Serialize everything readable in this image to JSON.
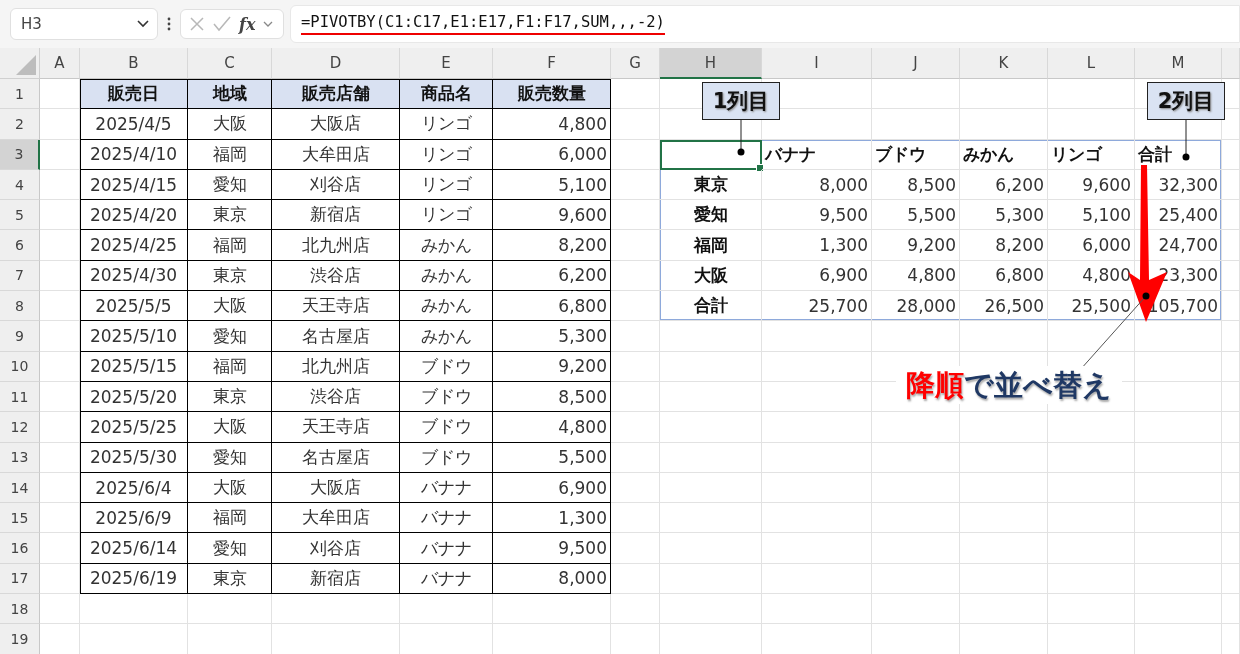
{
  "formula_bar": {
    "name_box": "H3",
    "function_button": "fx",
    "formula": "=PIVOTBY(C1:C17,E1:E17,F1:F17,SUM,,,-2)"
  },
  "columns": [
    {
      "label": "A",
      "selected": false
    },
    {
      "label": "B",
      "selected": false
    },
    {
      "label": "C",
      "selected": false
    },
    {
      "label": "D",
      "selected": false
    },
    {
      "label": "E",
      "selected": false
    },
    {
      "label": "F",
      "selected": false
    },
    {
      "label": "G",
      "selected": false
    },
    {
      "label": "H",
      "selected": true
    },
    {
      "label": "I",
      "selected": false
    },
    {
      "label": "J",
      "selected": false
    },
    {
      "label": "K",
      "selected": false
    },
    {
      "label": "L",
      "selected": false
    },
    {
      "label": "M",
      "selected": false
    }
  ],
  "rows": [
    {
      "label": "1",
      "selected": false
    },
    {
      "label": "2",
      "selected": false
    },
    {
      "label": "3",
      "selected": true
    },
    {
      "label": "4",
      "selected": false
    },
    {
      "label": "5",
      "selected": false
    },
    {
      "label": "6",
      "selected": false
    },
    {
      "label": "7",
      "selected": false
    },
    {
      "label": "8",
      "selected": false
    },
    {
      "label": "9",
      "selected": false
    },
    {
      "label": "10",
      "selected": false
    },
    {
      "label": "11",
      "selected": false
    },
    {
      "label": "12",
      "selected": false
    },
    {
      "label": "13",
      "selected": false
    },
    {
      "label": "14",
      "selected": false
    },
    {
      "label": "15",
      "selected": false
    },
    {
      "label": "16",
      "selected": false
    },
    {
      "label": "17",
      "selected": false
    },
    {
      "label": "18",
      "selected": false
    },
    {
      "label": "19",
      "selected": false
    }
  ],
  "source_table": {
    "header": [
      "販売日",
      "地域",
      "販売店舗",
      "商品名",
      "販売数量"
    ],
    "rows": [
      [
        "2025/4/5",
        "大阪",
        "大阪店",
        "リンゴ",
        "4,800"
      ],
      [
        "2025/4/10",
        "福岡",
        "大牟田店",
        "リンゴ",
        "6,000"
      ],
      [
        "2025/4/15",
        "愛知",
        "刈谷店",
        "リンゴ",
        "5,100"
      ],
      [
        "2025/4/20",
        "東京",
        "新宿店",
        "リンゴ",
        "9,600"
      ],
      [
        "2025/4/25",
        "福岡",
        "北九州店",
        "みかん",
        "8,200"
      ],
      [
        "2025/4/30",
        "東京",
        "渋谷店",
        "みかん",
        "6,200"
      ],
      [
        "2025/5/5",
        "大阪",
        "天王寺店",
        "みかん",
        "6,800"
      ],
      [
        "2025/5/10",
        "愛知",
        "名古屋店",
        "みかん",
        "5,300"
      ],
      [
        "2025/5/15",
        "福岡",
        "北九州店",
        "ブドウ",
        "9,200"
      ],
      [
        "2025/5/20",
        "東京",
        "渋谷店",
        "ブドウ",
        "8,500"
      ],
      [
        "2025/5/25",
        "大阪",
        "天王寺店",
        "ブドウ",
        "4,800"
      ],
      [
        "2025/5/30",
        "愛知",
        "名古屋店",
        "ブドウ",
        "5,500"
      ],
      [
        "2025/6/4",
        "大阪",
        "大阪店",
        "バナナ",
        "6,900"
      ],
      [
        "2025/6/9",
        "福岡",
        "大牟田店",
        "バナナ",
        "1,300"
      ],
      [
        "2025/6/14",
        "愛知",
        "刈谷店",
        "バナナ",
        "9,500"
      ],
      [
        "2025/6/19",
        "東京",
        "新宿店",
        "バナナ",
        "8,000"
      ]
    ]
  },
  "pivot_table": {
    "column_headers": [
      "バナナ",
      "ブドウ",
      "みかん",
      "リンゴ",
      "合計"
    ],
    "rows": [
      {
        "label": "東京",
        "values": [
          "8,000",
          "8,500",
          "6,200",
          "9,600",
          "32,300"
        ]
      },
      {
        "label": "愛知",
        "values": [
          "9,500",
          "5,500",
          "5,300",
          "5,100",
          "25,400"
        ]
      },
      {
        "label": "福岡",
        "values": [
          "1,300",
          "9,200",
          "8,200",
          "6,000",
          "24,700"
        ]
      },
      {
        "label": "大阪",
        "values": [
          "6,900",
          "4,800",
          "6,800",
          "4,800",
          "23,300"
        ]
      },
      {
        "label": "合計",
        "values": [
          "25,700",
          "28,000",
          "26,500",
          "25,500",
          "105,700"
        ]
      }
    ]
  },
  "callouts": [
    {
      "text": "1列目"
    },
    {
      "text": "2列目"
    }
  ],
  "note": {
    "parts": [
      {
        "text": "降順",
        "color": "#ff0000"
      },
      {
        "text": "で並べ替え",
        "color": "#1f3864"
      }
    ]
  }
}
